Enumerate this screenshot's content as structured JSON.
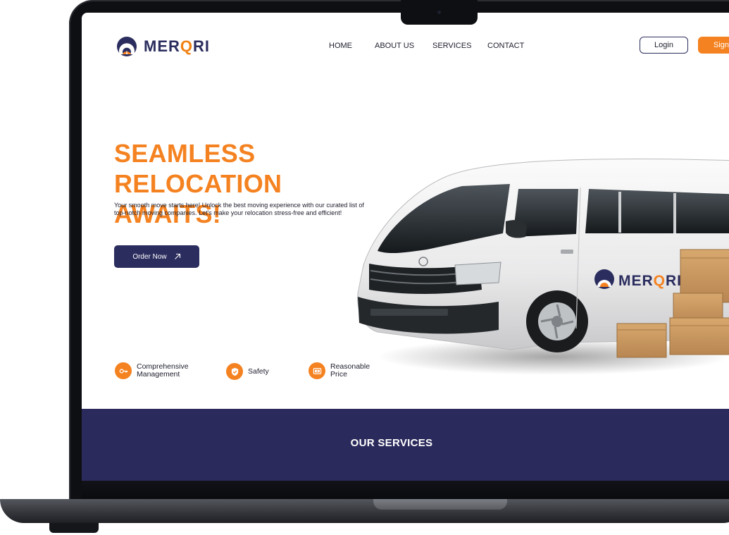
{
  "brand": {
    "name_pre": "MER",
    "name_q": "Q",
    "name_post": "RI",
    "accent_color": "#f58220",
    "primary_color": "#2b2d5e"
  },
  "nav": {
    "items": [
      "HOME",
      "ABOUT US",
      "SERVICES",
      "CONTACT"
    ]
  },
  "auth": {
    "login_label": "Login",
    "signup_label": "Sign"
  },
  "hero": {
    "title_line1": "SEAMLESS RELOCATION",
    "title_line2": "AWAITS!",
    "subtitle_line1": "Your smooth move starts here! Unlock the best moving experience with our curated list of",
    "subtitle_line2": "top-notch moving companies. Let's make your relocation stress-free and efficient!",
    "cta_label": "Order Now"
  },
  "features": [
    {
      "icon": "key-icon",
      "line1": "Comprehensive",
      "line2": "Management"
    },
    {
      "icon": "shield-icon",
      "line1": "Safety",
      "line2": ""
    },
    {
      "icon": "wallet-icon",
      "line1": "Reasonable",
      "line2": "Price"
    }
  ],
  "van": {
    "side_text_pre": "MER",
    "side_text_q": "Q",
    "side_text_post": "RI"
  },
  "services": {
    "title": "OUR SERVICES",
    "band_color": "#2b2a5c"
  }
}
